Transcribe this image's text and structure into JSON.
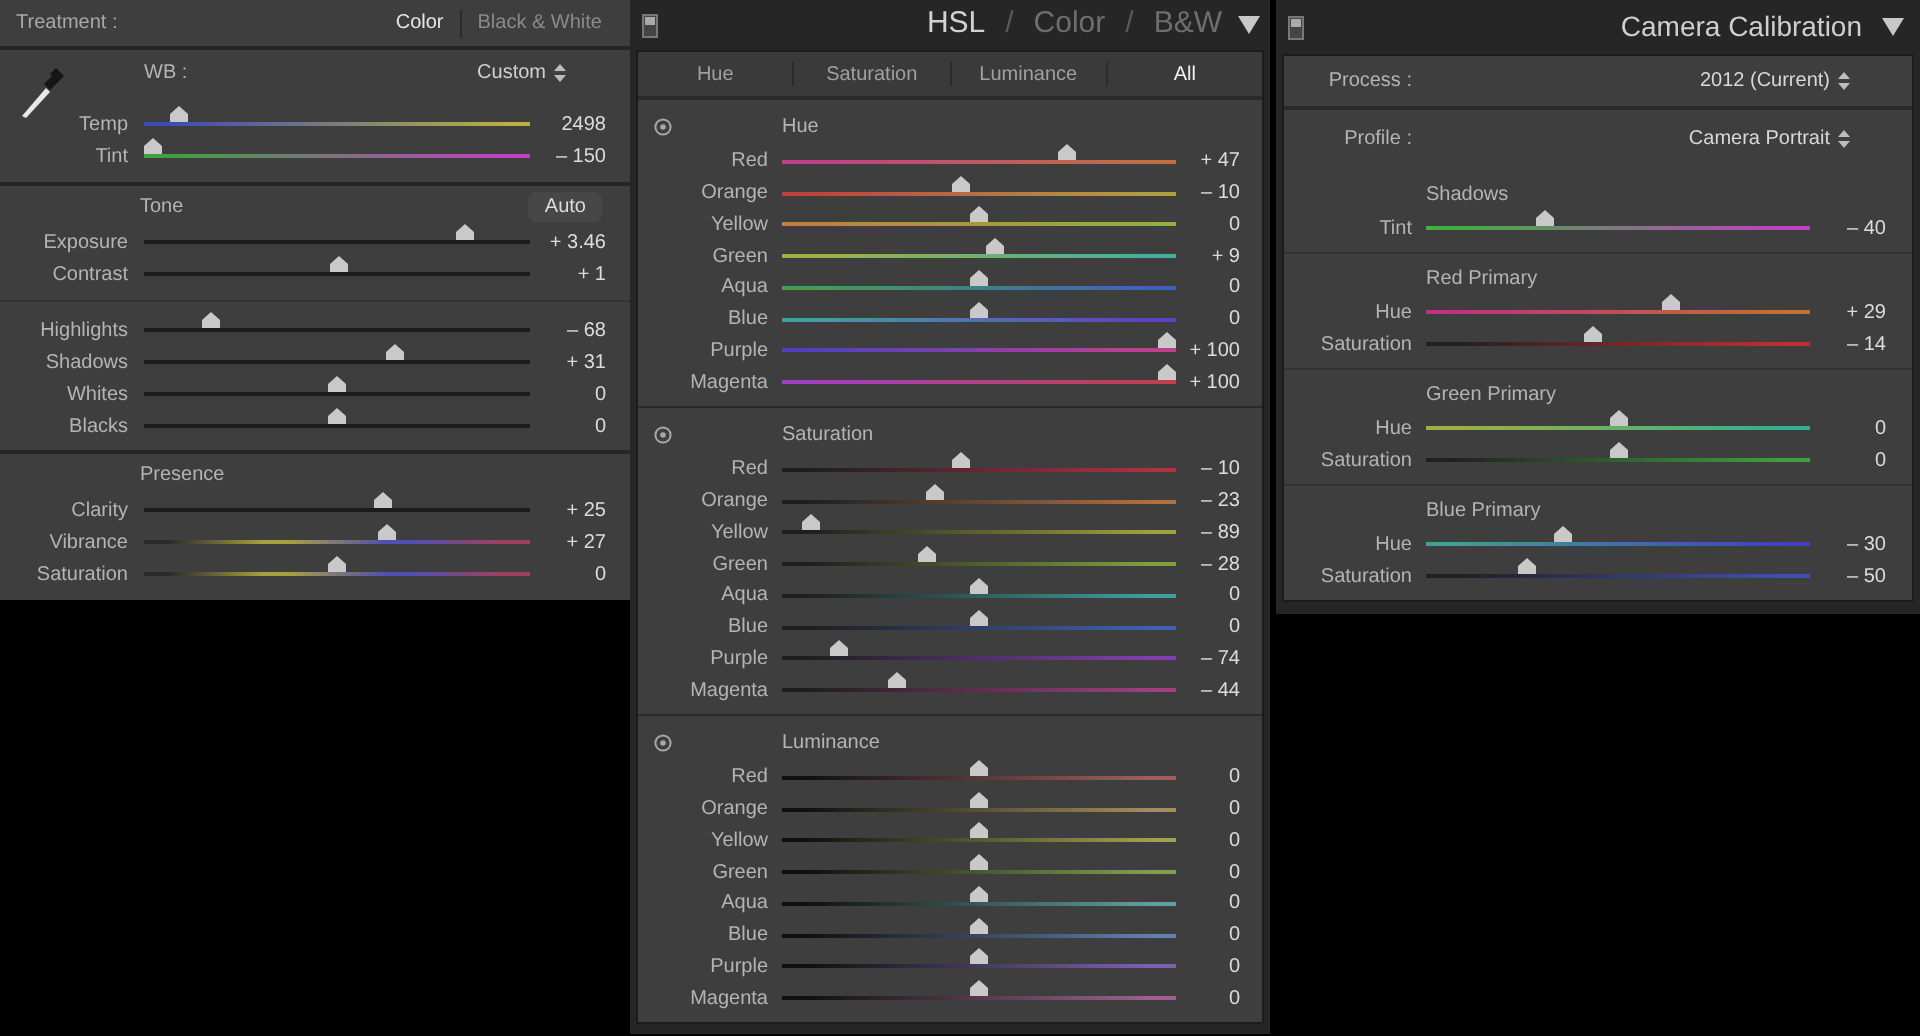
{
  "basic_panel": {
    "treatment": {
      "label": "Treatment :",
      "options": [
        {
          "label": "Color",
          "selected": true
        },
        {
          "label": "Black & White",
          "selected": false
        }
      ]
    },
    "white_balance": {
      "label": "WB :",
      "value": "Custom",
      "sliders": [
        {
          "label": "Temp",
          "level": 0.07,
          "value": "2498",
          "track": [
            {
              "color": "#3e4ab8"
            },
            {
              "color": "#b8b040"
            }
          ]
        },
        {
          "label": "Tint",
          "level": 0.0,
          "value": "– 150",
          "track": [
            {
              "color": "#3fa040"
            },
            {
              "color": "#c040c0"
            }
          ]
        }
      ]
    },
    "sections": [
      {
        "title": "Tone",
        "button": "Auto",
        "groups": [
          [
            {
              "label": "Exposure",
              "level": 0.846,
              "value": "+ 3.46"
            },
            {
              "label": "Contrast",
              "level": 0.505,
              "value": "+ 1"
            }
          ],
          [
            {
              "label": "Highlights",
              "level": 0.16,
              "value": "– 68"
            },
            {
              "label": "Shadows",
              "level": 0.655,
              "value": "+ 31"
            },
            {
              "label": "Whites",
              "level": 0.5,
              "value": "0"
            },
            {
              "label": "Blacks",
              "level": 0.5,
              "value": "0"
            }
          ]
        ]
      },
      {
        "title": "Presence",
        "groups": [
          [
            {
              "label": "Clarity",
              "level": 0.625,
              "value": "+ 25"
            },
            {
              "label": "Vibrance",
              "level": 0.635,
              "value": "+ 27",
              "track": [
                {
                  "color": "#2a2a2a"
                },
                {
                  "color": "#a8a040"
                },
                {
                  "color": "#5050b0"
                },
                {
                  "color": "#a04060"
                }
              ]
            },
            {
              "label": "Saturation",
              "level": 0.5,
              "value": "0",
              "track": [
                {
                  "color": "#2a2a2a"
                },
                {
                  "color": "#a8a040"
                },
                {
                  "color": "#5050b0"
                },
                {
                  "color": "#a04060"
                }
              ]
            }
          ]
        ]
      }
    ]
  },
  "hsl_panel": {
    "header": [
      {
        "kind": "mode",
        "label": "HSL",
        "selected": true
      },
      {
        "kind": "separator",
        "label": "/"
      },
      {
        "kind": "mode",
        "label": "Color",
        "selected": false
      },
      {
        "kind": "separator",
        "label": "/"
      },
      {
        "kind": "mode",
        "label": "B&W",
        "selected": false
      }
    ],
    "tabs": [
      {
        "label": "Hue",
        "selected": false
      },
      {
        "label": "Saturation",
        "selected": false
      },
      {
        "label": "Luminance",
        "selected": false
      },
      {
        "label": "All",
        "selected": true
      }
    ],
    "sections": [
      {
        "title": "Hue",
        "sliders": [
          {
            "label": "Red",
            "level": 0.735,
            "value": "+ 47",
            "track": [
              {
                "color": "#c0408a"
              },
              {
                "color": "#c07040"
              }
            ]
          },
          {
            "label": "Orange",
            "level": 0.45,
            "value": "– 10",
            "track": [
              {
                "color": "#c04040"
              },
              {
                "color": "#b0a040"
              }
            ]
          },
          {
            "label": "Yellow",
            "level": 0.5,
            "value": "0",
            "track": [
              {
                "color": "#c08040"
              },
              {
                "color": "#90b040"
              }
            ]
          },
          {
            "label": "Green",
            "level": 0.545,
            "value": "+ 9",
            "track": [
              {
                "color": "#a0b040"
              },
              {
                "color": "#40b0a0"
              }
            ]
          },
          {
            "label": "Aqua",
            "level": 0.5,
            "value": "0",
            "track": [
              {
                "color": "#40a050"
              },
              {
                "color": "#4060c0"
              }
            ]
          },
          {
            "label": "Blue",
            "level": 0.5,
            "value": "0",
            "track": [
              {
                "color": "#40a0a0"
              },
              {
                "color": "#6040c0"
              }
            ]
          },
          {
            "label": "Purple",
            "level": 1.0,
            "value": "+ 100",
            "track": [
              {
                "color": "#5040c0"
              },
              {
                "color": "#c04090"
              }
            ]
          },
          {
            "label": "Magenta",
            "level": 1.0,
            "value": "+ 100",
            "track": [
              {
                "color": "#a040c0"
              },
              {
                "color": "#c04050"
              }
            ]
          }
        ]
      },
      {
        "title": "Saturation",
        "sliders": [
          {
            "label": "Red",
            "level": 0.45,
            "value": "– 10",
            "track": [
              {
                "color": "#1e1e1e"
              },
              {
                "color": "#b03040"
              }
            ]
          },
          {
            "label": "Orange",
            "level": 0.385,
            "value": "– 23",
            "track": [
              {
                "color": "#1e1e1e"
              },
              {
                "color": "#b07040"
              }
            ]
          },
          {
            "label": "Yellow",
            "level": 0.055,
            "value": "– 89",
            "track": [
              {
                "color": "#1e1e1e"
              },
              {
                "color": "#a0a040"
              }
            ]
          },
          {
            "label": "Green",
            "level": 0.36,
            "value": "– 28",
            "track": [
              {
                "color": "#1e1e1e"
              },
              {
                "color": "#80a040"
              }
            ]
          },
          {
            "label": "Aqua",
            "level": 0.5,
            "value": "0",
            "track": [
              {
                "color": "#1e1e1e"
              },
              {
                "color": "#40a0a0"
              }
            ]
          },
          {
            "label": "Blue",
            "level": 0.5,
            "value": "0",
            "track": [
              {
                "color": "#1e1e1e"
              },
              {
                "color": "#4060b0"
              }
            ]
          },
          {
            "label": "Purple",
            "level": 0.13,
            "value": "– 74",
            "track": [
              {
                "color": "#1e1e1e"
              },
              {
                "color": "#8040b0"
              }
            ]
          },
          {
            "label": "Magenta",
            "level": 0.28,
            "value": "– 44",
            "track": [
              {
                "color": "#1e1e1e"
              },
              {
                "color": "#a04080"
              }
            ]
          }
        ]
      },
      {
        "title": "Luminance",
        "sliders": [
          {
            "label": "Red",
            "level": 0.5,
            "value": "0",
            "track": [
              {
                "color": "#101010"
              },
              {
                "color": "#a06060"
              }
            ]
          },
          {
            "label": "Orange",
            "level": 0.5,
            "value": "0",
            "track": [
              {
                "color": "#101010"
              },
              {
                "color": "#a09060"
              }
            ]
          },
          {
            "label": "Yellow",
            "level": 0.5,
            "value": "0",
            "track": [
              {
                "color": "#101010"
              },
              {
                "color": "#a0a050"
              }
            ]
          },
          {
            "label": "Green",
            "level": 0.5,
            "value": "0",
            "track": [
              {
                "color": "#101010"
              },
              {
                "color": "#80a050"
              }
            ]
          },
          {
            "label": "Aqua",
            "level": 0.5,
            "value": "0",
            "track": [
              {
                "color": "#101010"
              },
              {
                "color": "#60a0a0"
              }
            ]
          },
          {
            "label": "Blue",
            "level": 0.5,
            "value": "0",
            "track": [
              {
                "color": "#101010"
              },
              {
                "color": "#6080b0"
              }
            ]
          },
          {
            "label": "Purple",
            "level": 0.5,
            "value": "0",
            "track": [
              {
                "color": "#101010"
              },
              {
                "color": "#8060b0"
              }
            ]
          },
          {
            "label": "Magenta",
            "level": 0.5,
            "value": "0",
            "track": [
              {
                "color": "#101010"
              },
              {
                "color": "#a06090"
              }
            ]
          }
        ]
      }
    ]
  },
  "calibration_panel": {
    "title": "Camera Calibration",
    "settings": [
      {
        "label": "Process :",
        "value": "2012 (Current)"
      },
      {
        "label": "Profile :",
        "value": "Camera Portrait"
      }
    ],
    "sections": [
      {
        "title": "Shadows",
        "sliders": [
          {
            "label": "Tint",
            "level": 0.3,
            "value": "– 40",
            "track": [
              {
                "color": "#40b040"
              },
              {
                "color": "#c040c0"
              }
            ]
          }
        ]
      },
      {
        "title": "Red Primary",
        "sliders": [
          {
            "label": "Hue",
            "level": 0.645,
            "value": "+ 29",
            "track": [
              {
                "color": "#c03080"
              },
              {
                "color": "#c07030"
              }
            ]
          },
          {
            "label": "Saturation",
            "level": 0.43,
            "value": "– 14",
            "track": [
              {
                "color": "#202020"
              },
              {
                "color": "#c03030"
              }
            ]
          }
        ]
      },
      {
        "title": "Green Primary",
        "sliders": [
          {
            "label": "Hue",
            "level": 0.5,
            "value": "0",
            "track": [
              {
                "color": "#a0b040"
              },
              {
                "color": "#30b090"
              }
            ]
          },
          {
            "label": "Saturation",
            "level": 0.5,
            "value": "0",
            "track": [
              {
                "color": "#202020"
              },
              {
                "color": "#40a040"
              }
            ]
          }
        ]
      },
      {
        "title": "Blue Primary",
        "sliders": [
          {
            "label": "Hue",
            "level": 0.35,
            "value": "– 30",
            "track": [
              {
                "color": "#40a090"
              },
              {
                "color": "#4040c0"
              }
            ]
          },
          {
            "label": "Saturation",
            "level": 0.25,
            "value": "– 50",
            "track": [
              {
                "color": "#202020"
              },
              {
                "color": "#4050b0"
              }
            ]
          }
        ]
      }
    ]
  }
}
